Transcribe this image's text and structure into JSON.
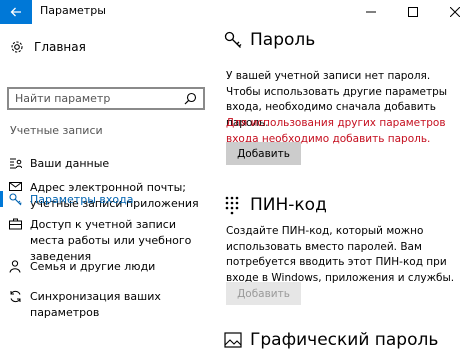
{
  "window": {
    "title": "Параметры",
    "minimize_glyph": "—",
    "maximize_glyph": "☐",
    "close_glyph": "✕"
  },
  "sidebar": {
    "home_label": "Главная",
    "search_placeholder": "Найти параметр",
    "section_label": "Учетные записи",
    "items": [
      {
        "label": "Ваши данные",
        "icon": "person-card-icon"
      },
      {
        "label": "Адрес электронной почты; учетные записи приложения",
        "icon": "mail-icon"
      },
      {
        "label": "Параметры входа",
        "icon": "key-icon",
        "active": true
      },
      {
        "label": "Доступ к учетной записи места работы или учебного заведения",
        "icon": "briefcase-icon"
      },
      {
        "label": "Семья и другие люди",
        "icon": "people-icon"
      },
      {
        "label": "Синхронизация ваших параметров",
        "icon": "sync-icon"
      }
    ]
  },
  "main": {
    "password": {
      "title": "Пароль",
      "description": "У вашей учетной записи нет пароля. Чтобы использовать другие параметры входа, необходимо сначала добавить пароль.",
      "warning": "Для использования других параметров входа необходимо добавить пароль.",
      "button_label": "Добавить"
    },
    "pin": {
      "title": "ПИН-код",
      "description": "Создайте ПИН-код, который можно использовать вместо паролей. Вам потребуется вводить этот ПИН-код при входе в Windows, приложения и службы.",
      "button_label": "Добавить"
    },
    "picture_password": {
      "title": "Графический пароль"
    }
  },
  "colors": {
    "accent": "#0078d7",
    "active_text": "#0063b1",
    "warning": "#c50f1f",
    "button_bg": "#cccccc"
  }
}
